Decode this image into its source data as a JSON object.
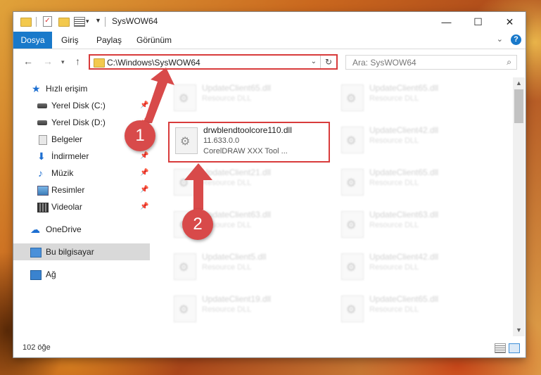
{
  "window": {
    "title": "SysWOW64",
    "controls": {
      "minimize": "—",
      "maximize": "☐",
      "close": "✕"
    }
  },
  "ribbon": {
    "tabs": [
      "Dosya",
      "Giriş",
      "Paylaş",
      "Görünüm"
    ],
    "help": "?"
  },
  "nav": {
    "address": "C:\\Windows\\SysWOW64",
    "search_placeholder": "Ara: SysWOW64"
  },
  "sidebar": {
    "items": [
      {
        "label": "Hızlı erişim",
        "icon": "star-icon"
      },
      {
        "label": "Yerel Disk (C:)",
        "icon": "drive-icon",
        "pinned": true
      },
      {
        "label": "Yerel Disk (D:)",
        "icon": "drive-icon",
        "pinned": true
      },
      {
        "label": "Belgeler",
        "icon": "documents-icon",
        "pinned": true
      },
      {
        "label": "İndirmeler",
        "icon": "download-icon",
        "pinned": true
      },
      {
        "label": "Müzik",
        "icon": "music-icon",
        "pinned": true
      },
      {
        "label": "Resimler",
        "icon": "pictures-icon",
        "pinned": true
      },
      {
        "label": "Videolar",
        "icon": "videos-icon",
        "pinned": true
      },
      {
        "label": "OneDrive",
        "icon": "cloud-icon"
      },
      {
        "label": "Bu bilgisayar",
        "icon": "computer-icon",
        "selected": true
      },
      {
        "label": "Ağ",
        "icon": "network-icon"
      }
    ]
  },
  "files": {
    "left": [
      {
        "name": "UpdateClient65.dll",
        "desc": "Resource DLL"
      },
      {
        "name": "drwblendtoolcore110.dll",
        "version": "11.633.0.0",
        "desc": "CorelDRAW XXX Tool ...",
        "highlighted": true
      },
      {
        "name": "UpdateClient21.dll",
        "desc": "Resource DLL"
      },
      {
        "name": "UpdateClient63.dll",
        "desc": "Resource DLL"
      },
      {
        "name": "UpdateClient5.dll",
        "desc": "Resource DLL"
      },
      {
        "name": "UpdateClient19.dll",
        "desc": "Resource DLL"
      }
    ],
    "right": [
      {
        "name": "UpdateClient65.dll",
        "desc": "Resource DLL"
      },
      {
        "name": "UpdateClient42.dll",
        "desc": "Resource DLL"
      },
      {
        "name": "UpdateClient65.dll",
        "desc": "Resource DLL"
      },
      {
        "name": "UpdateClient63.dll",
        "desc": "Resource DLL"
      },
      {
        "name": "UpdateClient42.dll",
        "desc": "Resource DLL"
      },
      {
        "name": "UpdateClient65.dll",
        "desc": "Resource DLL"
      }
    ]
  },
  "status": {
    "count": "102 öğe"
  },
  "annotations": {
    "step1": "1",
    "step2": "2"
  },
  "colors": {
    "accent": "#1979ca",
    "highlight": "#d83b3b"
  }
}
